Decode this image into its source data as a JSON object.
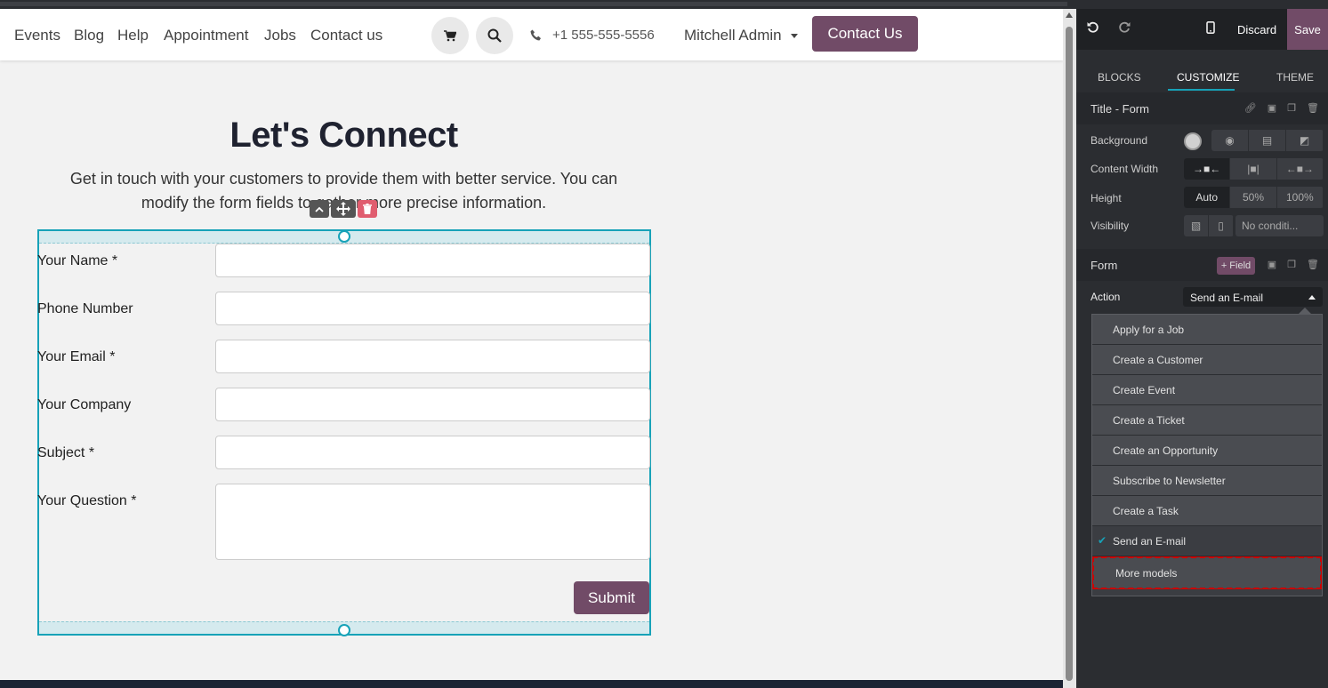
{
  "nav": {
    "links": [
      "Events",
      "Blog",
      "Help",
      "Appointment",
      "Jobs",
      "Contact us"
    ],
    "phone": "+1 555-555-5556",
    "user": "Mitchell Admin",
    "cta": "Contact Us"
  },
  "hero": {
    "title": "Let's Connect",
    "lead_1": "Get in touch with your customers to provide them with better service. You can",
    "lead_2": "modify the form fields to gather more precise information."
  },
  "form": {
    "fields": [
      {
        "label": "Your Name *"
      },
      {
        "label": "Phone Number"
      },
      {
        "label": "Your Email *"
      },
      {
        "label": "Your Company"
      },
      {
        "label": "Subject *"
      },
      {
        "label": "Your Question *"
      }
    ],
    "submit": "Submit"
  },
  "panel": {
    "discard": "Discard",
    "save": "Save",
    "tabs": [
      "BLOCKS",
      "CUSTOMIZE",
      "THEME"
    ],
    "active_tab": "CUSTOMIZE",
    "section_title": "Title - Form",
    "background_label": "Background",
    "content_width_label": "Content Width",
    "height_label": "Height",
    "height_options": [
      "Auto",
      "50%",
      "100%"
    ],
    "visibility_label": "Visibility",
    "visibility_value": "No conditi...",
    "form_label": "Form",
    "add_field": "+ Field",
    "action_label": "Action",
    "action_value": "Send an E-mail",
    "action_options": [
      "Apply for a Job",
      "Create a Customer",
      "Create Event",
      "Create a Ticket",
      "Create an Opportunity",
      "Subscribe to Newsletter",
      "Create a Task",
      "Send an E-mail"
    ],
    "more_models": "More models"
  },
  "colors": {
    "brand": "#714b67",
    "accent": "#17a2b8",
    "panel_bg": "#2b2d31"
  }
}
